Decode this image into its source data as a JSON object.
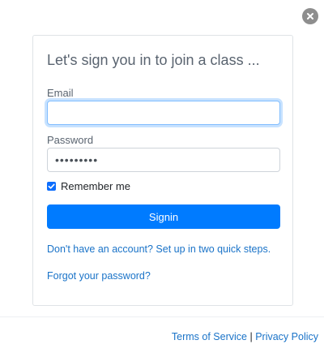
{
  "title": "Let's sign you in to join a class ...",
  "form": {
    "email_label": "Email",
    "email_value": "",
    "password_label": "Password",
    "password_value": "•••••••••",
    "remember_label": "Remember me",
    "remember_checked": true,
    "signin_label": "Signin"
  },
  "links": {
    "signup": "Don't have an account? Set up in two quick steps.",
    "forgot": "Forgot your password?"
  },
  "footer": {
    "terms": "Terms of Service",
    "separator": "|",
    "privacy": "Privacy Policy"
  },
  "icons": {
    "close": "close-icon",
    "check": "check-icon"
  },
  "colors": {
    "primary": "#007bff",
    "link": "#1a73c8",
    "close_bg": "#8e8e8e"
  }
}
